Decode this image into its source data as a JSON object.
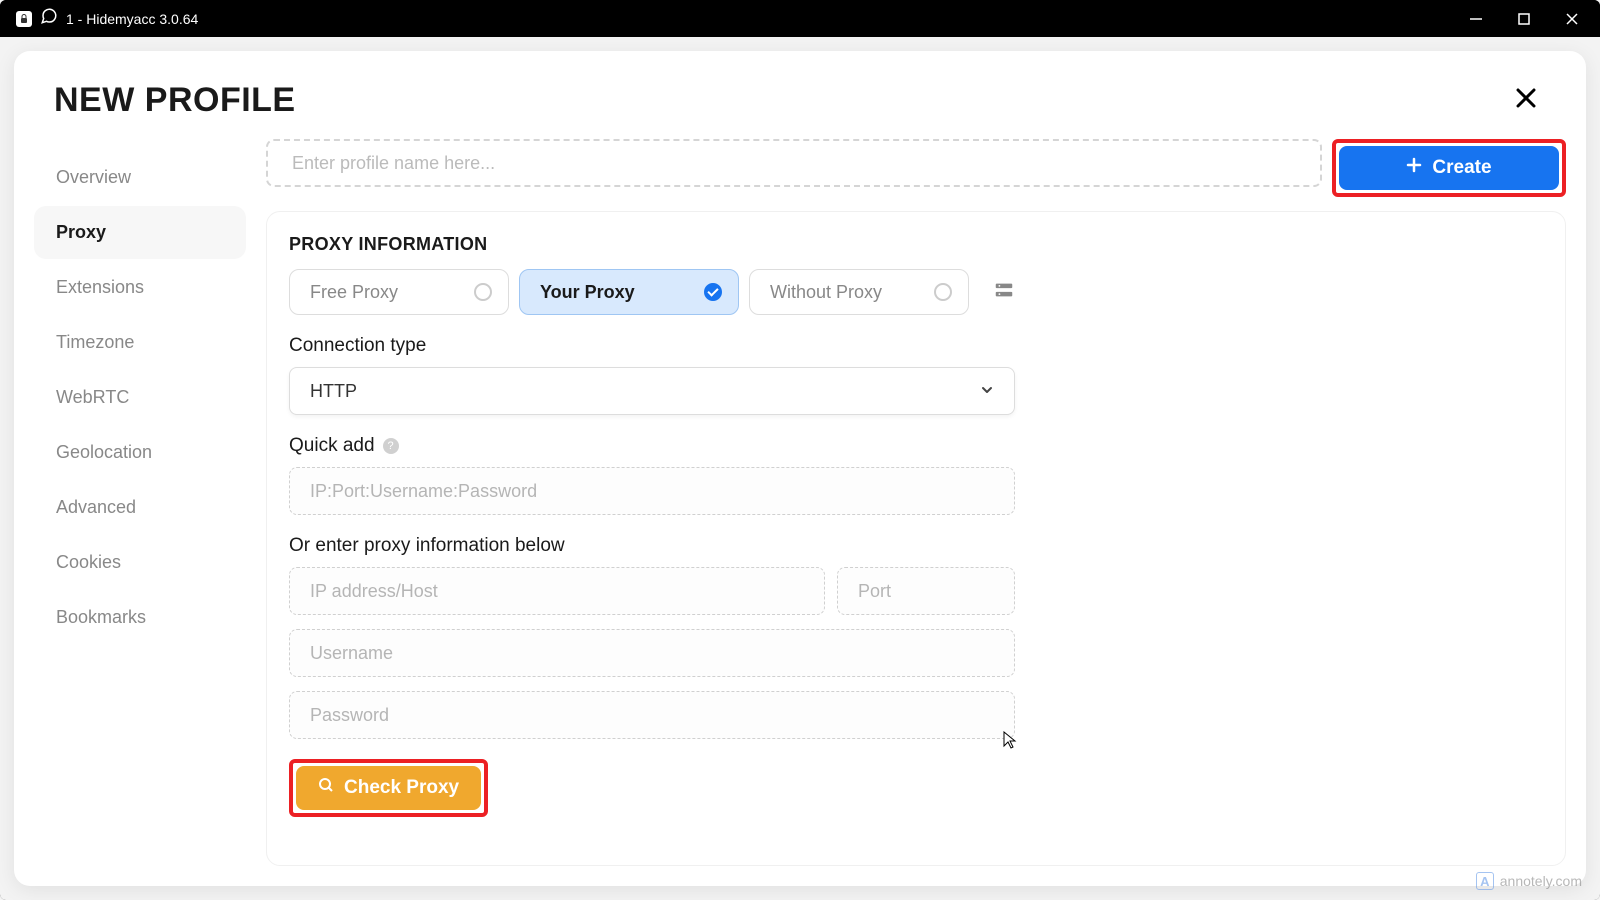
{
  "window": {
    "title": "1 - Hidemyacc 3.0.64"
  },
  "modal": {
    "title": "NEW PROFILE"
  },
  "sidebar": {
    "items": [
      {
        "label": "Overview"
      },
      {
        "label": "Proxy"
      },
      {
        "label": "Extensions"
      },
      {
        "label": "Timezone"
      },
      {
        "label": "WebRTC"
      },
      {
        "label": "Geolocation"
      },
      {
        "label": "Advanced"
      },
      {
        "label": "Cookies"
      },
      {
        "label": "Bookmarks"
      }
    ]
  },
  "profileName": {
    "placeholder": "Enter profile name here..."
  },
  "createButton": {
    "label": "Create"
  },
  "proxySection": {
    "heading": "PROXY INFORMATION",
    "options": {
      "free": "Free Proxy",
      "your": "Your Proxy",
      "without": "Without Proxy"
    },
    "connectionTypeLabel": "Connection type",
    "connectionTypeValue": "HTTP",
    "quickAddLabel": "Quick add",
    "quickAddPlaceholder": "IP:Port:Username:Password",
    "orEnterLabel": "Or enter proxy information below",
    "ipPlaceholder": "IP address/Host",
    "portPlaceholder": "Port",
    "usernamePlaceholder": "Username",
    "passwordPlaceholder": "Password",
    "checkButtonLabel": "Check Proxy"
  },
  "watermark": {
    "icon": "A",
    "text": "annotely.com"
  }
}
